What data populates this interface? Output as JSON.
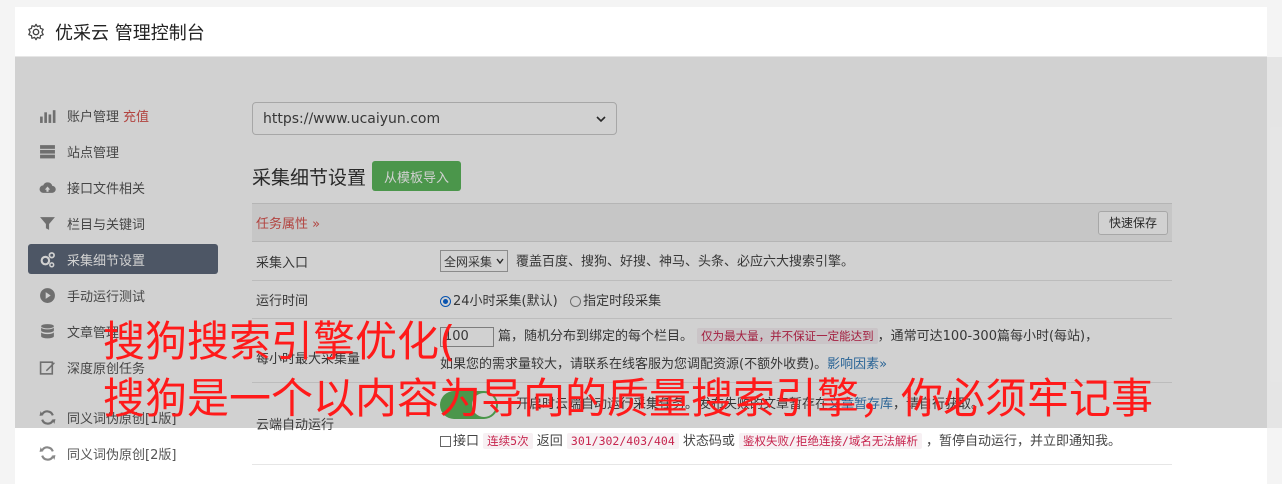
{
  "header": {
    "title": "优采云 管理控制台"
  },
  "sidebar": {
    "items": [
      {
        "label": "账户管理",
        "badge": "充值",
        "icon": "bar-chart-icon"
      },
      {
        "label": "站点管理",
        "icon": "server-icon"
      },
      {
        "label": "接口文件相关",
        "icon": "cloud-upload-icon"
      },
      {
        "label": "栏目与关键词",
        "icon": "filter-icon"
      },
      {
        "label": "采集细节设置",
        "icon": "gears-icon",
        "active": true
      },
      {
        "label": "手动运行测试",
        "icon": "play-circle-icon"
      },
      {
        "label": "文章管理",
        "icon": "database-icon"
      },
      {
        "label": "深度原创任务",
        "icon": "edit-icon"
      },
      {
        "label": "同义词伪原创[1版]",
        "icon": "refresh-icon"
      },
      {
        "label": "同义词伪原创[2版]",
        "icon": "refresh-icon"
      }
    ]
  },
  "content": {
    "site_select": "https://www.ucaiyun.com",
    "section_title": "采集细节设置",
    "import_button": "从模板导入",
    "task_attr": "任务属性",
    "quick_save": "快速保存",
    "rows": {
      "entry": {
        "label": "采集入口",
        "select": "全网采集",
        "desc": "覆盖百度、搜狗、好搜、神马、头条、必应六大搜索引擎。"
      },
      "time": {
        "label": "运行时间",
        "opt1": "24小时采集(默认)",
        "opt2": "指定时段采集"
      },
      "max": {
        "label": "每小时最大采集量",
        "value": "100",
        "t1": "篇，随机分布到绑定的每个栏目。",
        "warn": "仅为最大量，并不保证一定能达到",
        "t2": "，通常可达100-300篇每小时(每站)，",
        "t3": "如果您的需求量较大，请联系在线客服为您调配资源(不额外收费)。",
        "link": "影响因素"
      },
      "cloud": {
        "label": "云端自动运行",
        "desc1": "开启时云端自动运行采集任务。发布失败的文章暂存在",
        "desc_link": "文章暂存库",
        "desc2": "，请自行获取。",
        "cb_label": "接口",
        "code1": "连续5次",
        "t_back": "返回",
        "code2": "301/302/403/404",
        "t_or": "状态码或",
        "code3": "鉴权失败/拒绝连接/域名无法解析",
        "t_end": "，暂停自动运行，并立即通知我。"
      }
    }
  },
  "headline": {
    "line1": "搜狗搜索引擎优化(",
    "line2": "搜狗是一个以内容为导向的质量搜索引擎，你必须牢记事"
  }
}
